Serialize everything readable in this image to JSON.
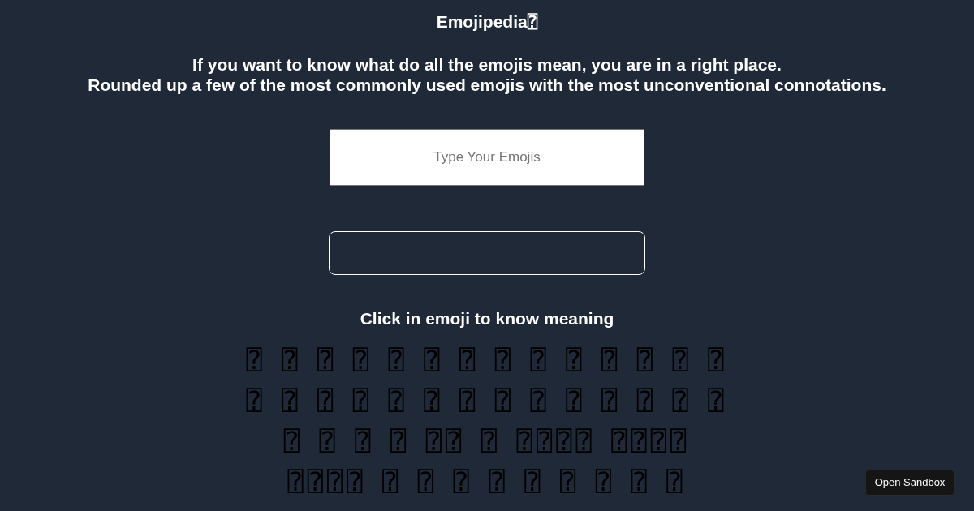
{
  "title": "Emojipedia⍰",
  "intro": [
    "If you want to know what do all the emojis mean, you are in a right place.",
    "Rounded up a few of the most commonly used emojis with the most unconventional connotations."
  ],
  "search": {
    "placeholder": "Type Your Emojis"
  },
  "emoji_heading": "Click in emoji to know meaning",
  "emojis": [
    "⍰",
    "⍰",
    "⍰",
    "⍰",
    "⍰",
    "⍰",
    "⍰",
    "⍰",
    "⍰",
    "⍰",
    "⍰",
    "⍰",
    "⍰",
    "⍰",
    "⍰",
    "⍰",
    "⍰",
    "⍰",
    "⍰",
    "⍰",
    "⍰",
    "⍰",
    "⍰",
    "⍰",
    "⍰",
    "⍰",
    "⍰",
    "⍰",
    "⍰",
    "⍰",
    "⍰",
    "⍰",
    "⍰⍰",
    "⍰",
    "⍰⍰⍰⍰",
    "⍰⍰⍰⍰",
    "⍰⍰⍰⍰",
    "⍰",
    "⍰",
    "⍰",
    "⍰",
    "⍰",
    "⍰",
    "⍰",
    "⍰",
    "⍰"
  ],
  "sandbox_button": "Open Sandbox"
}
